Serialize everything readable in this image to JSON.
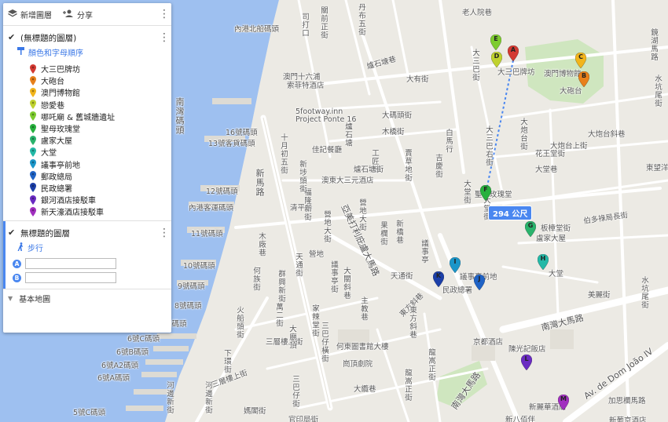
{
  "toolbar": {
    "add_layer": "新增圖層",
    "share": "分享"
  },
  "layer1": {
    "title": "(無標題的圖層)",
    "style_link": "顏色和字母順序",
    "items": [
      {
        "label": "大三巴牌坊",
        "color": "#d33a32"
      },
      {
        "label": "大砲台",
        "color": "#e8801a"
      },
      {
        "label": "澳門博物館",
        "color": "#f2b51c"
      },
      {
        "label": "戀愛巷",
        "color": "#c0d22f"
      },
      {
        "label": "哪吒廟 & 舊城牆遺址",
        "color": "#7dcc2f"
      },
      {
        "label": "聖母玫瑰堂",
        "color": "#27b03d"
      },
      {
        "label": "盧家大屋",
        "color": "#2ab36c"
      },
      {
        "label": "大堂",
        "color": "#23b9a7"
      },
      {
        "label": "議事亭前地",
        "color": "#1b96c9"
      },
      {
        "label": "郵政總局",
        "color": "#1f63c6"
      },
      {
        "label": "民政總署",
        "color": "#1c3fa8"
      },
      {
        "label": "銀河酒店接駁車",
        "color": "#6a2bc2"
      },
      {
        "label": "新天濠酒店接駁車",
        "color": "#a12fbf"
      }
    ]
  },
  "layer2": {
    "title": "無標題的圖層",
    "mode": "步行",
    "point_a": "A",
    "point_b": "B",
    "value_a": "",
    "value_b": ""
  },
  "base_map": "基本地圖",
  "map": {
    "distance": "294 公尺",
    "markers": [
      {
        "letter": "A",
        "color": "#d33a32"
      },
      {
        "letter": "B",
        "color": "#e8801a"
      },
      {
        "letter": "C",
        "color": "#f2b51c"
      },
      {
        "letter": "D",
        "color": "#c0d22f"
      },
      {
        "letter": "E",
        "color": "#7dcc2f"
      },
      {
        "letter": "F",
        "color": "#27b03d"
      },
      {
        "letter": "G",
        "color": "#2ab36c"
      },
      {
        "letter": "H",
        "color": "#23b9a7"
      },
      {
        "letter": "I",
        "color": "#1b96c9"
      },
      {
        "letter": "J",
        "color": "#1f63c6"
      },
      {
        "letter": "K",
        "color": "#1c3fa8"
      },
      {
        "letter": "L",
        "color": "#6a2bc2"
      },
      {
        "letter": "M",
        "color": "#a12fbf"
      }
    ],
    "labels": {
      "l1": "內港北船碼頭",
      "l2": "澳門十六浦",
      "l3": "索菲特酒店",
      "l4": "5footway.inn",
      "l5": "Project Ponte 16",
      "l6": "16號碼頭",
      "l7": "佳記餐廳",
      "l8": "澳東大三元酒店",
      "l9": "13號客貨碼頭",
      "l10": "12號碼頭",
      "l11": "內港客運碼頭",
      "l12": "11號碼頭",
      "l13": "10號碼頭",
      "l14": "南灣碼頭",
      "l15": "9號碼頭",
      "l16": "8號碼頭",
      "l17": "7號碼頭",
      "l18": "6號C碼頭",
      "l19": "6號B碼頭",
      "l20": "6號A2碼頭",
      "l21": "6號A碼頭",
      "l22": "5號C碼頭",
      "l23": "大三巴牌坊",
      "l24": "澳門博物館",
      "l25": "大砲台",
      "l26": "聖母玫瑰堂",
      "l27": "盧家大屋",
      "l28": "大堂",
      "l29": "議事亭前地",
      "l30": "民政總署",
      "l31": "何東圖書館大樓",
      "l32": "崗頂劇院",
      "l33": "京都酒店",
      "l34": "陳光記飯店",
      "l35": "新麗華酒店",
      "l36": "新八佰伴",
      "l37": "新葡京酒店",
      "l38": "南灣大馬路",
      "l39": "Av. de Dom João IV",
      "l40": "營地",
      "l41": "板樟堂街",
      "l42": "伯多祿局長街",
      "l43": "美麗街",
      "l44": "水坑尾街",
      "l45": "龍嵩正街",
      "l46": "營地大街",
      "l47": "新馬路",
      "l48": "大纜巷",
      "l49": "火船頭街",
      "l50": "河邊新街",
      "l51": "下環街",
      "l52": "大堂街",
      "l53": "官印局街",
      "l54": "媽閣街",
      "l55": "三巴仔街",
      "l56": "亞美打利庇盧大馬路",
      "l57": "大三巴街",
      "l58": "大炮台街",
      "l59": "白馬行",
      "l60": "天通街",
      "l61": "東方斜巷",
      "l62": "南灣大馬路",
      "l63": "議事亭",
      "l64": "大堂巷",
      "l65": "花王堂街",
      "l66": "鏡湖馬路",
      "l67": "大炮台斜巷",
      "l68": "大炮台上街",
      "l69": "東望洋街",
      "l70": "關前正街",
      "l71": "爐石塘巷",
      "l72": "大有街",
      "l73": "司打口",
      "l74": "丹布五街",
      "l75": "老人院巷",
      "l76": "大碼頭街",
      "l77": "木橋街",
      "l78": "清平巷",
      "l79": "營地大街",
      "l80": "賣草地街",
      "l81": "工匠街",
      "l82": "十月初五街",
      "l83": "果欄街",
      "l84": "新橋巷",
      "l85": "爐石塘街",
      "l86": "吉慶街",
      "l87": "大關斜巷",
      "l88": "福隆新街",
      "l89": "三層樓上街",
      "l90": "議事亭街",
      "l91": "家辣堂街",
      "l92": "大三巴右街",
      "l93": "東方斜巷",
      "l94": "群興新街",
      "l95": "何族街",
      "l96": "天通街",
      "l97": "河邊新街",
      "l98": "木廠巷",
      "l99": "大廟頂",
      "l100": "萬二街",
      "l101": "主教巷",
      "l102": "三巴仔橫街",
      "l103": "龍嵩正街",
      "l104": "三層樓上街",
      "l105": "加思欄馬路",
      "l106": "水坑尾街",
      "l107": "大堂街",
      "l108": "新埗頭街",
      "l109": "爐石塘"
    }
  }
}
